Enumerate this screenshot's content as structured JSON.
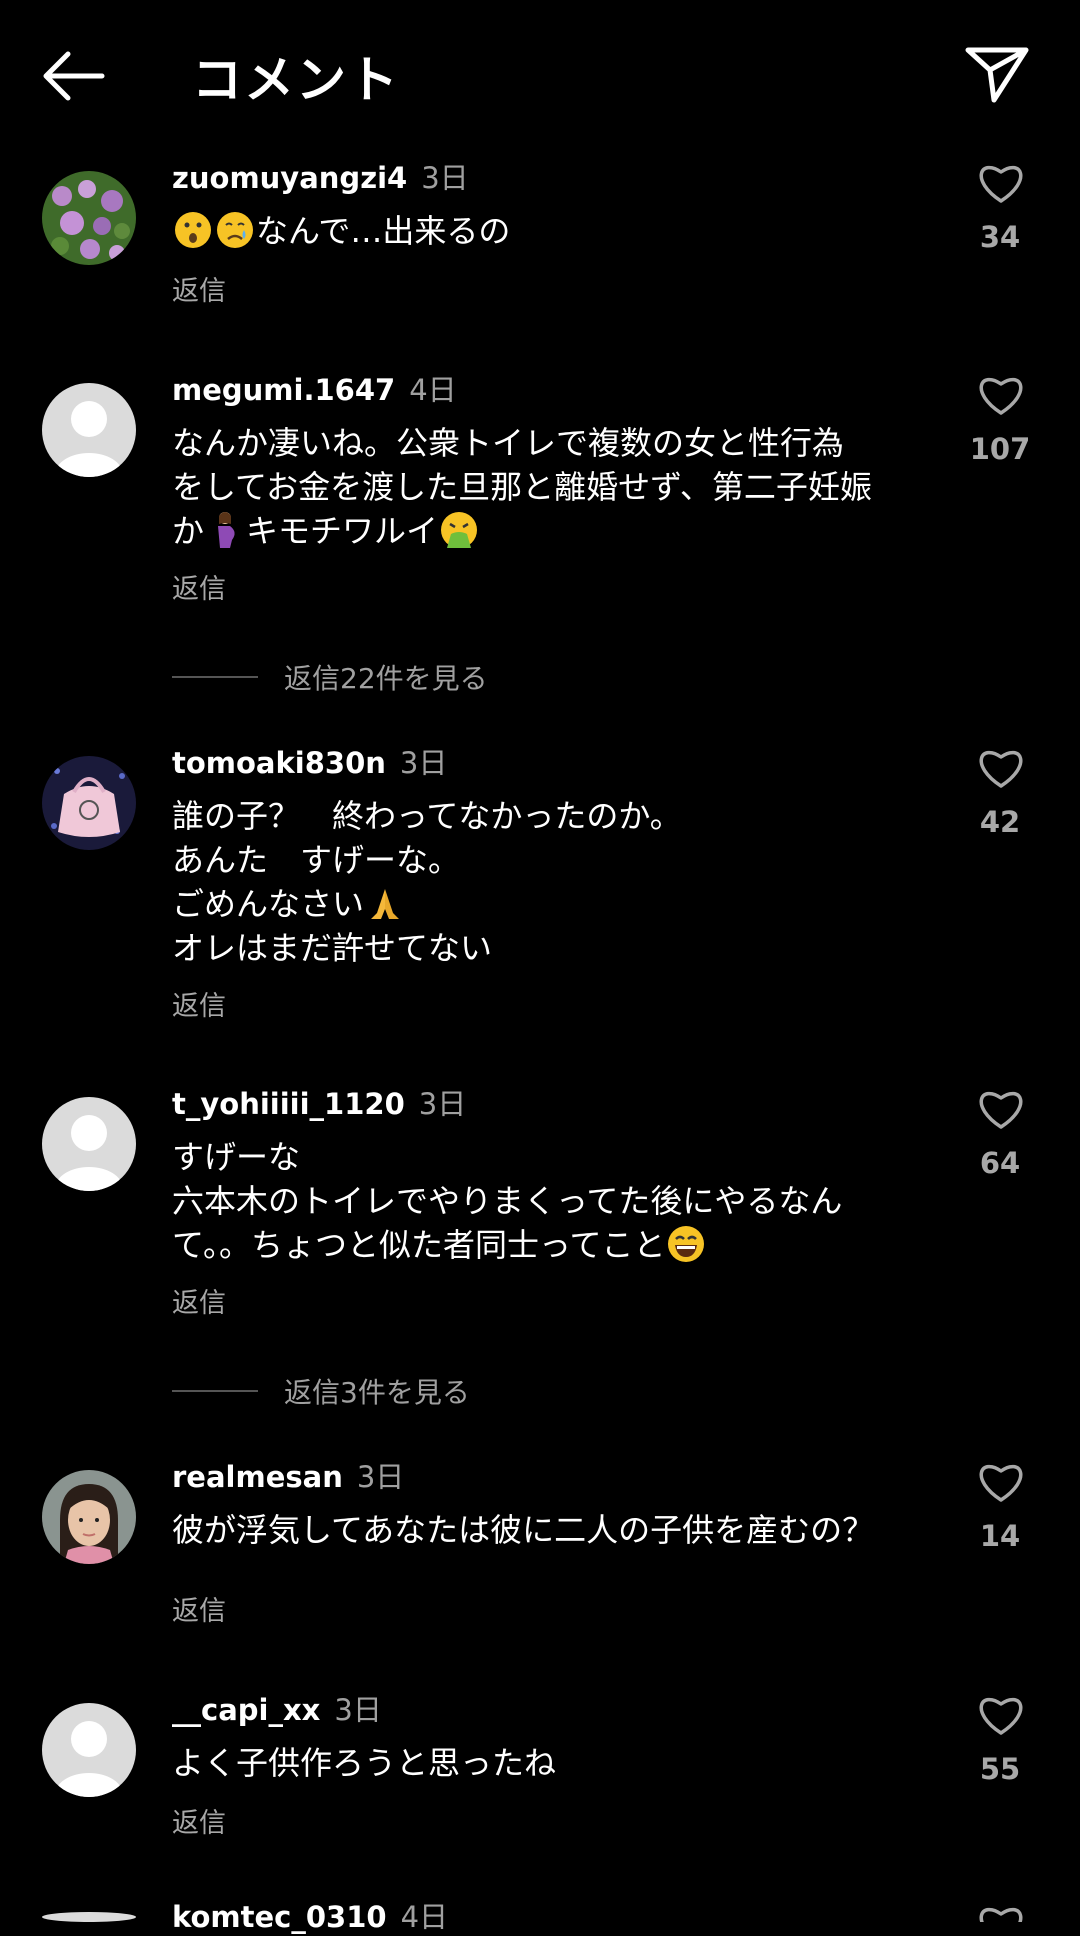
{
  "header": {
    "title": "コメント",
    "back_icon": "arrow-left-icon",
    "send_icon": "paper-plane-icon"
  },
  "comments": [
    {
      "username": "zuomuyangzi4",
      "time": "3日",
      "text": "なんで…出来るの",
      "emojis": [
        "hushed-face",
        "crying-face"
      ],
      "reply": "返信",
      "likes": "34"
    },
    {
      "username": "megumi.1647",
      "time": "4日",
      "lines": [
        "なんか凄いね。公衆トイレで複数の女と性行為",
        "をしてお金を渡した旦那と離婚せず、第二子妊娠",
        "か",
        "キモチワルイ"
      ],
      "emojis": [
        "pregnant-woman",
        "vomiting-face"
      ],
      "reply": "返信",
      "likes": "107",
      "view_replies": "返信22件を見る"
    },
    {
      "username": "tomoaki830n",
      "time": "3日",
      "lines": [
        "誰の子？　終わってなかったのか。",
        "あんた　すげーな。",
        "ごめんなさい",
        "オレはまだ許せてない"
      ],
      "emojis": [
        "folded-hands"
      ],
      "reply": "返信",
      "likes": "42"
    },
    {
      "username": "t_yohiiiii_1120",
      "time": "3日",
      "lines": [
        "すげーな",
        "六本木のトイレでやりまくってた後にやるなん",
        "て。。ちょつと似た者同士ってこと"
      ],
      "emojis": [
        "laughing-face"
      ],
      "reply": "返信",
      "likes": "64",
      "view_replies": "返信3件を見る"
    },
    {
      "username": "realmesan",
      "time": "3日",
      "text": "彼が浮気してあなたは彼に二人の子供を産むの？",
      "reply": "返信",
      "likes": "14"
    },
    {
      "username": "__capi_xx",
      "time": "3日",
      "text": "よく子供作ろうと思ったね",
      "reply": "返信",
      "likes": "55"
    },
    {
      "username": "komtec_0310",
      "time": "4日"
    }
  ],
  "colors": {
    "background": "#000000",
    "text": "#ffffff",
    "muted": "#a8a8a8",
    "default_avatar": "#dbdbdb"
  }
}
